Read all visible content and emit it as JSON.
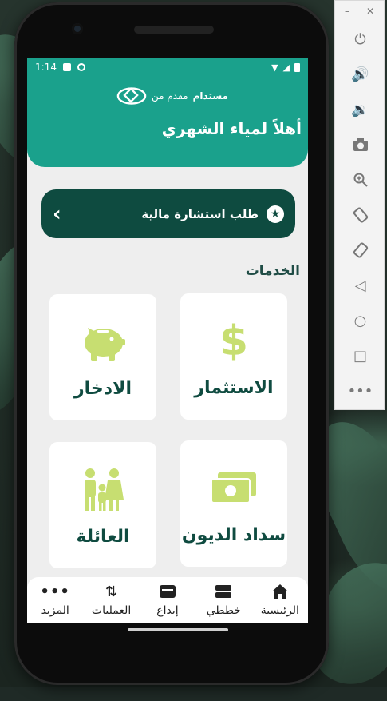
{
  "status": {
    "time": "1:14"
  },
  "header": {
    "brand_name": "مستدام",
    "brand_suffix": "مقدم من",
    "greeting": "أهلاً لمياء الشهري"
  },
  "consult": {
    "label": "طلب استشارة مالية"
  },
  "services": {
    "title": "الخدمات",
    "cards": [
      {
        "label": "الاستثمار",
        "icon": "dollar-icon"
      },
      {
        "label": "الادخار",
        "icon": "piggy-bank-icon"
      },
      {
        "label": "سداد الديون",
        "icon": "cash-icon"
      },
      {
        "label": "العائلة",
        "icon": "family-icon"
      }
    ]
  },
  "nav": {
    "items": [
      {
        "label": "الرئيسية",
        "icon": "home-icon"
      },
      {
        "label": "خططي",
        "icon": "plans-icon"
      },
      {
        "label": "إيداع",
        "icon": "wallet-icon"
      },
      {
        "label": "العمليات",
        "icon": "transfer-icon"
      },
      {
        "label": "المزيد",
        "icon": "more-icon"
      }
    ]
  },
  "colors": {
    "primary": "#1aa18c",
    "dark": "#0e4b40",
    "accent": "#c7de71"
  }
}
